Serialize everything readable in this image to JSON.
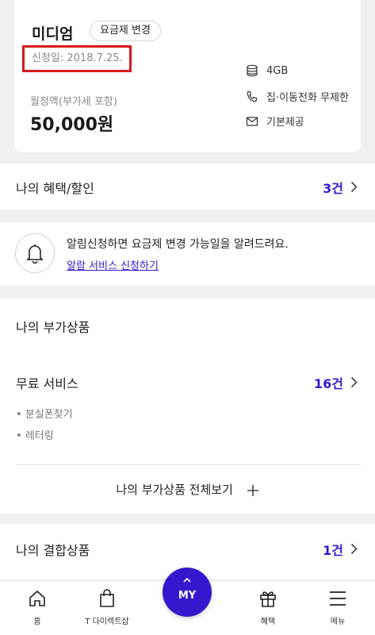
{
  "plan": {
    "name": "미디엄",
    "change_label": "요금제 변경",
    "signup_date": "신청일: 2018.7.25.",
    "monthly_label": "월정액(부가세 포함)",
    "monthly_value": "50,000원",
    "features": [
      {
        "icon": "database-icon",
        "label": "4GB"
      },
      {
        "icon": "phone-icon",
        "label": "집·이동전화 무제한"
      },
      {
        "icon": "mail-icon",
        "label": "기본제공"
      }
    ]
  },
  "benefits": {
    "title": "나의 혜택/할인",
    "count": "3건"
  },
  "alarm": {
    "message": "알림신청하면 요금제 변경 가능일을 알려드려요.",
    "link": "알람 서비스 신청하기"
  },
  "addons": {
    "title": "나의 부가상품",
    "free_title": "무료 서비스",
    "free_count": "16건",
    "items": [
      "분실폰찾기",
      "레터링"
    ],
    "view_all": "나의 부가상품 전체보기"
  },
  "combo": {
    "title": "나의 결합상품",
    "count": "1건"
  },
  "nav": {
    "home": "홈",
    "direct": "T 다이렉트샵",
    "my": "MY",
    "benefit": "혜택",
    "menu": "메뉴"
  },
  "colors": {
    "accent": "#3617ce",
    "highlight": "#d7191f"
  }
}
